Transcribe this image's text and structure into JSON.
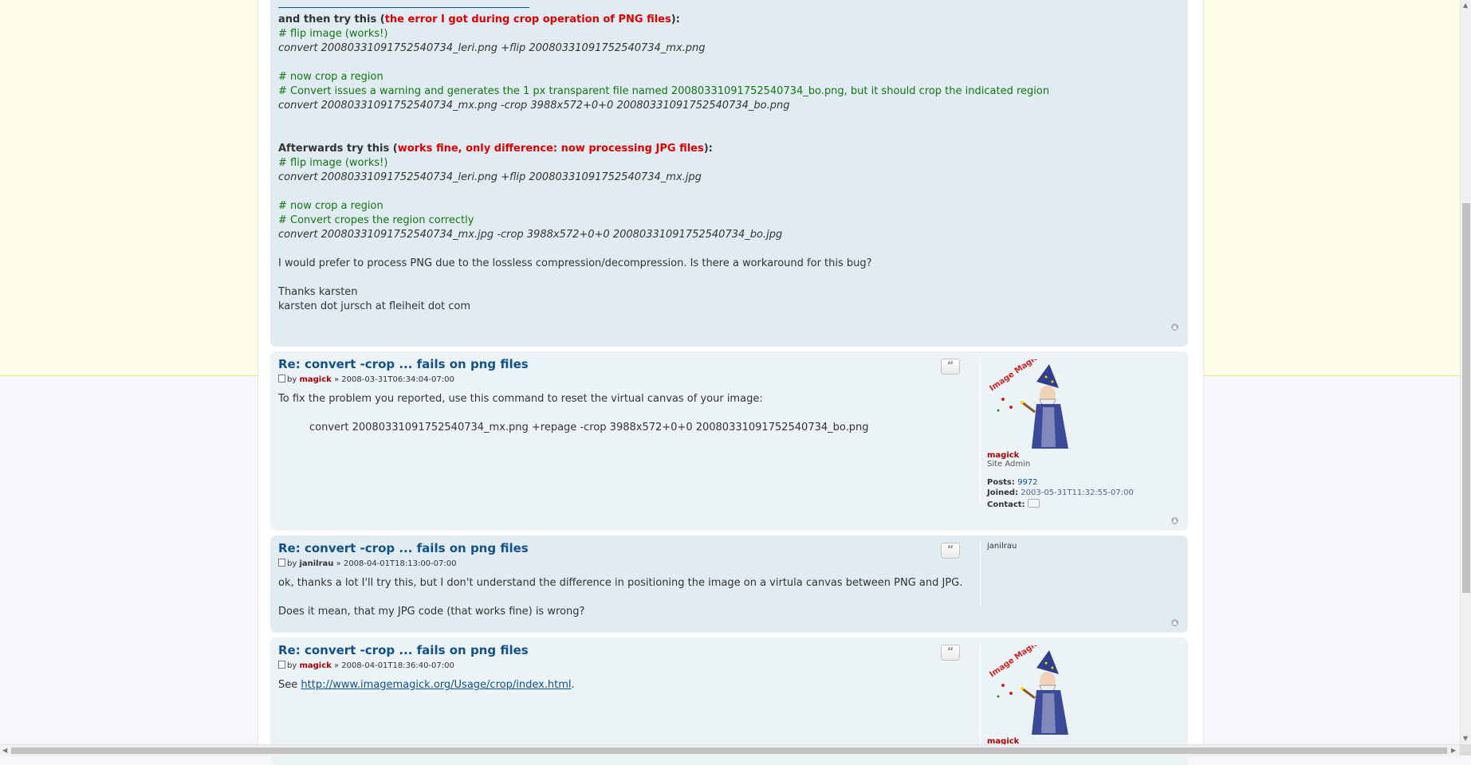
{
  "post1": {
    "lines": [
      {
        "segments": [
          {
            "t": "and then try this (",
            "c": "bold"
          },
          {
            "t": "the error I got during crop operation of PNG files",
            "c": "red"
          },
          {
            "t": "):",
            "c": "bold"
          }
        ]
      },
      {
        "segments": [
          {
            "t": "# flip image (works!)",
            "c": "green"
          }
        ]
      },
      {
        "segments": [
          {
            "t": "convert 20080331091752540734_leri.png +flip 20080331091752540734_mx.png",
            "c": "code-italic"
          }
        ]
      },
      {
        "segments": []
      },
      {
        "segments": [
          {
            "t": "# now crop a region",
            "c": "green"
          }
        ]
      },
      {
        "segments": [
          {
            "t": "# Convert issues a warning and generates the 1 px transparent file named 20080331091752540734_bo.png, but it should crop the indicated region",
            "c": "green"
          }
        ]
      },
      {
        "segments": [
          {
            "t": "convert 20080331091752540734_mx.png -crop 3988x572+0+0 20080331091752540734_bo.png",
            "c": "code-italic"
          }
        ]
      },
      {
        "segments": []
      },
      {
        "segments": []
      },
      {
        "segments": [
          {
            "t": "Afterwards try this (",
            "c": "bold"
          },
          {
            "t": "works fine, only difference: now processing JPG files",
            "c": "red"
          },
          {
            "t": "):",
            "c": "bold"
          }
        ]
      },
      {
        "segments": [
          {
            "t": "# flip image (works!)",
            "c": "green"
          }
        ]
      },
      {
        "segments": [
          {
            "t": "convert 20080331091752540734_leri.png +flip 20080331091752540734_mx.jpg",
            "c": "code-italic"
          }
        ]
      },
      {
        "segments": []
      },
      {
        "segments": [
          {
            "t": "# now crop a region",
            "c": "green"
          }
        ]
      },
      {
        "segments": [
          {
            "t": "# Convert cropes the region correctly",
            "c": "green"
          }
        ]
      },
      {
        "segments": [
          {
            "t": "convert 20080331091752540734_mx.jpg -crop 3988x572+0+0 20080331091752540734_bo.jpg",
            "c": "code-italic"
          }
        ]
      },
      {
        "segments": []
      },
      {
        "segments": [
          {
            "t": "I would prefer to process PNG due to the lossless compression/decompression. Is there a workaround for this bug?",
            "c": ""
          }
        ]
      },
      {
        "segments": []
      },
      {
        "segments": [
          {
            "t": "Thanks karsten",
            "c": ""
          }
        ]
      },
      {
        "segments": [
          {
            "t": "karsten dot jursch at fleiheit dot com",
            "c": ""
          }
        ]
      }
    ]
  },
  "post2": {
    "title": "Re: convert -crop ... fails on png files",
    "by": "by",
    "author": "magick",
    "sep": "»",
    "date": "2008-03-31T06:34:04-07:00",
    "text": "To fix the problem you reported, use this command to reset the virtual canvas of your image:",
    "code": "convert 20080331091752540734_mx.png +repage -crop 3988x572+0+0 20080331091752540734_bo.png",
    "quote_glyph": "“",
    "profile": {
      "avatar_text": "Image Magick",
      "name": "magick",
      "rank": "Site Admin",
      "posts_label": "Posts:",
      "posts_value": "9972",
      "joined_label": "Joined:",
      "joined_value": "2003-05-31T11:32:55-07:00",
      "contact_label": "Contact:"
    }
  },
  "post3": {
    "title": "Re: convert -crop ... fails on png files",
    "by": "by",
    "author": "janilrau",
    "sep": "»",
    "date": "2008-04-01T18:13:00-07:00",
    "line1": "ok, thanks a lot I'll try this, but I don't understand the difference in positioning the image on a virtula canvas between PNG and JPG.",
    "line2": "Does it mean, that my JPG code (that works fine) is wrong?",
    "quote_glyph": "“",
    "profile_name": "janilrau"
  },
  "post4": {
    "title": "Re: convert -crop ... fails on png files",
    "by": "by",
    "author": "magick",
    "sep": "»",
    "date": "2008-04-01T18:36:40-07:00",
    "see": "See",
    "link": "http://www.imagemagick.org/Usage/crop/index.html",
    "period": ".",
    "quote_glyph": "“",
    "profile_name_partial": "magick"
  },
  "top_glyph": "▲",
  "colors": {
    "link": "#105289",
    "admin_red": "#aa0000",
    "highlight_red": "#dd0000",
    "comment_green": "#117711",
    "post_bg": "#e1ebf2",
    "post_bg_alt": "#ecf3f7"
  }
}
